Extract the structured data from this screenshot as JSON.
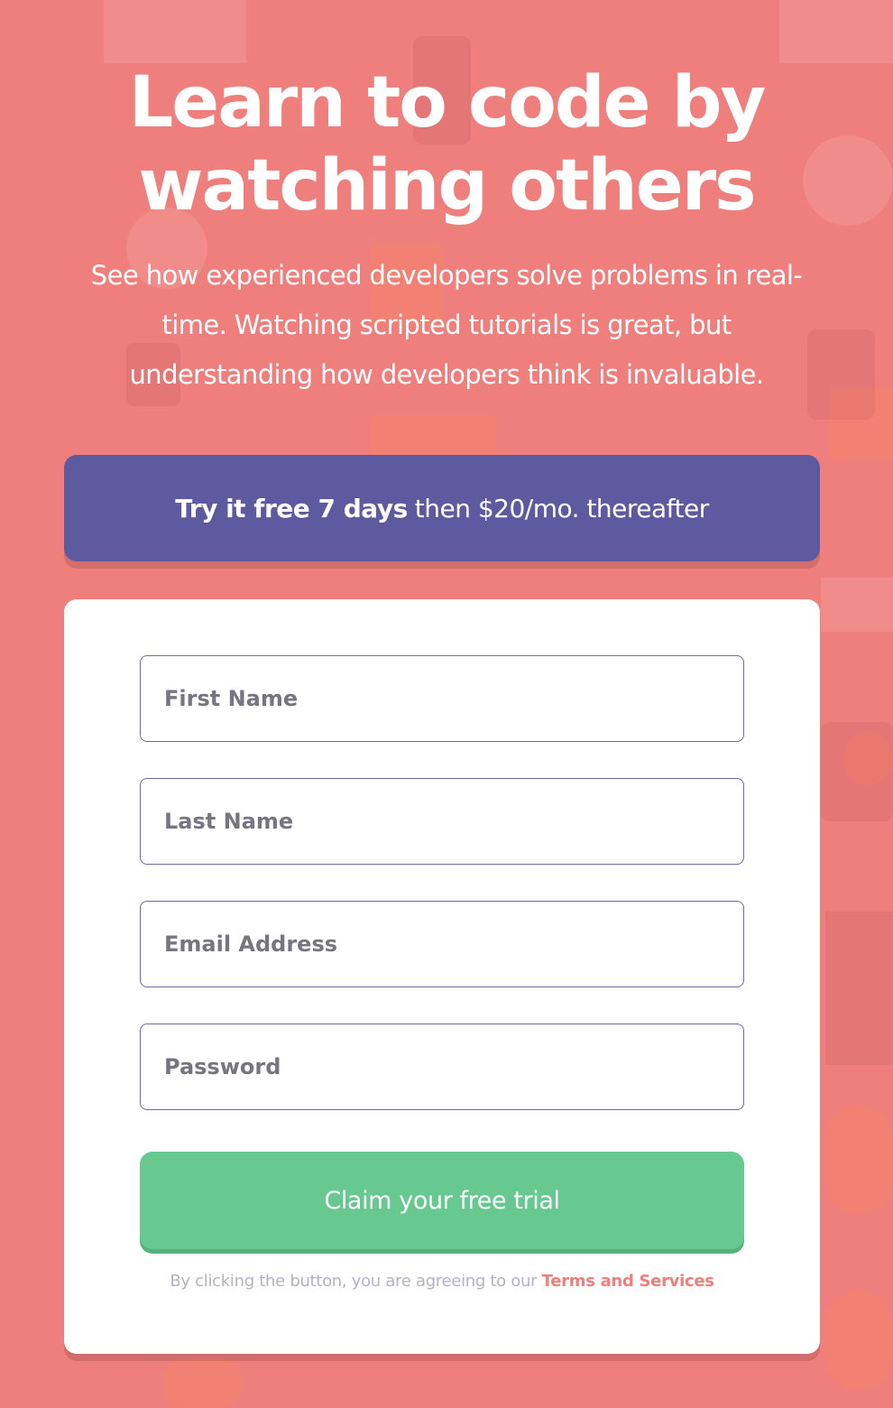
{
  "hero": {
    "title": "Learn to code by watching others",
    "description": "See how experienced developers solve problems in real-time. Watching scripted tutorials is great, but understanding how developers think is invaluable."
  },
  "offer": {
    "bold": "Try it free 7 days",
    "rest": "then $20/mo. thereafter"
  },
  "form": {
    "first_name_placeholder": "First Name",
    "last_name_placeholder": "Last Name",
    "email_placeholder": "Email Address",
    "password_placeholder": "Password",
    "submit_label": "Claim your free trial",
    "terms_prefix": "By clicking the button, you are agreeing to our",
    "terms_link": "Terms and Services"
  },
  "colors": {
    "background": "#ef7f7c",
    "banner": "#5e5aa0",
    "cta": "#67c98f",
    "link": "#ef7f7c"
  }
}
